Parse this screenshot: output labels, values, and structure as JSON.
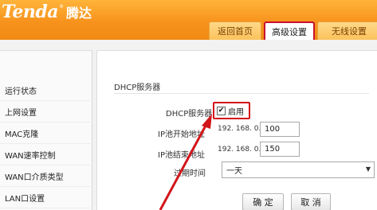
{
  "brand": {
    "name_en": "Tenda",
    "reg_mark": "®",
    "name_cn": "腾达"
  },
  "top_tabs": [
    {
      "label": "返回首页",
      "active": false
    },
    {
      "label": "高级设置",
      "active": true
    },
    {
      "label": "无线设置",
      "active": false
    }
  ],
  "sidebar": {
    "items": [
      {
        "label": "运行状态"
      },
      {
        "label": "上网设置"
      },
      {
        "label": "MAC克隆"
      },
      {
        "label": "WAN速率控制"
      },
      {
        "label": "WAN口介质类型"
      },
      {
        "label": "LAN口设置"
      }
    ]
  },
  "dhcp": {
    "section_title": "DHCP服务器",
    "server_label": "DHCP服务器",
    "enable_label": "启用",
    "enabled": true,
    "checkmark": "✔",
    "start_label": "IP池开始地址",
    "start_prefix": "192. 168. 0.",
    "start_value": "100",
    "end_label": "IP池结束地址",
    "end_prefix": "192. 168. 0.",
    "end_value": "150",
    "lease_label": "过期时间",
    "lease_value": "一天",
    "ok_label": "确 定",
    "cancel_label": "取 消"
  },
  "colors": {
    "header": "#f7931d",
    "highlight": "#d2151a"
  }
}
